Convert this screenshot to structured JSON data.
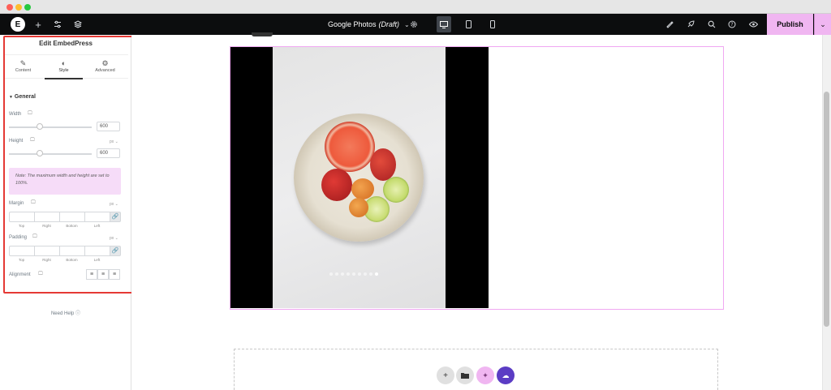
{
  "toolbar": {
    "document_title": "Google Photos",
    "document_status": "(Draft)",
    "publish_label": "Publish",
    "icons": [
      "elementor-logo-icon",
      "plus-icon",
      "sliders-icon",
      "layers-icon",
      "chevron-down-icon",
      "gear-icon",
      "desktop-icon",
      "tablet-icon",
      "mobile-icon",
      "pen-icon",
      "rocket-icon",
      "search-icon",
      "help-icon",
      "eye-icon",
      "chevron-down-icon"
    ]
  },
  "panel": {
    "title": "Edit EmbedPress",
    "tabs": [
      {
        "label": "Content",
        "icon": "pencil-icon"
      },
      {
        "label": "Style",
        "icon": "contrast-icon"
      },
      {
        "label": "Advanced",
        "icon": "gear-icon"
      }
    ],
    "active_tab": "Style",
    "section": "General",
    "width": {
      "label": "Width",
      "value": "600",
      "level": 0.37
    },
    "height": {
      "label": "Height",
      "value": "600",
      "unit": "px",
      "level": 0.37
    },
    "note": "Note: The maximum width and height are set to 100%.",
    "margin": {
      "label": "Margin",
      "unit": "px",
      "sides": [
        "Top",
        "Right",
        "Bottom",
        "Left"
      ]
    },
    "padding": {
      "label": "Padding",
      "unit": "px",
      "sides": [
        "Top",
        "Right",
        "Bottom",
        "Left"
      ]
    },
    "alignment": {
      "label": "Alignment"
    },
    "need_help": "Need Help"
  },
  "carousel": {
    "dot_count": 9,
    "active_dot": 9
  },
  "colors": {
    "accent": "#f0b6f1",
    "highlight": "#e53935",
    "toolbar_bg": "#0c0d0e"
  }
}
